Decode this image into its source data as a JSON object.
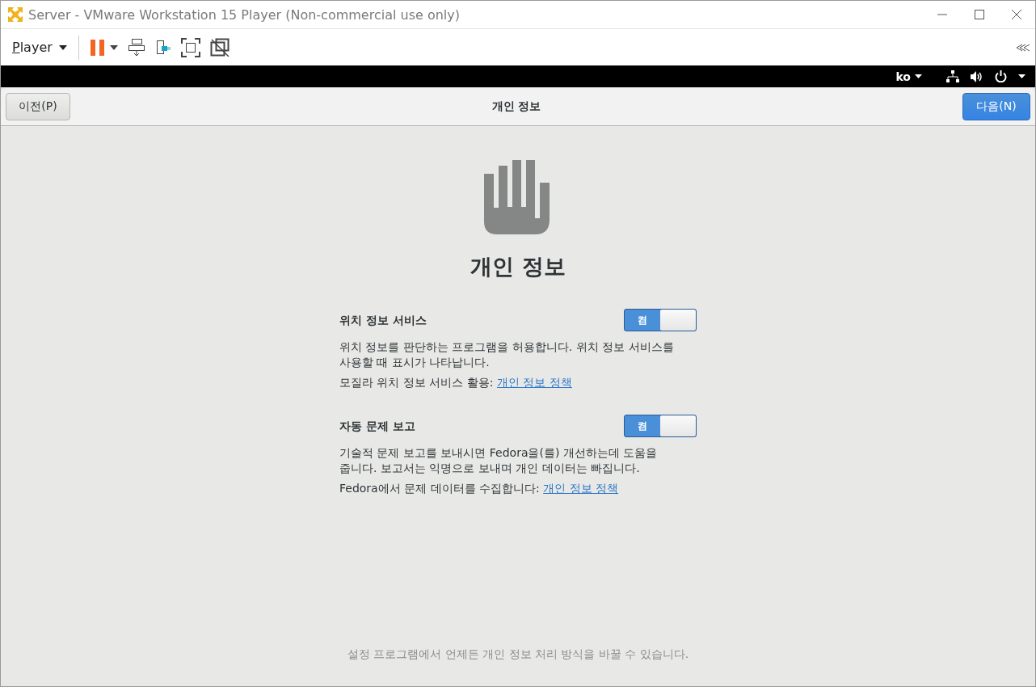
{
  "window": {
    "title": "Server - VMware Workstation 15 Player (Non-commercial use only)"
  },
  "toolbar": {
    "menu": "Player"
  },
  "top_bar": {
    "language": "ko"
  },
  "header": {
    "back": "이전(P)",
    "title": "개인 정보",
    "next": "다음(N)"
  },
  "page": {
    "heading": "개인 정보",
    "settings": [
      {
        "title": "위치 정보 서비스",
        "on": true,
        "switch_label": "켬",
        "description": "위치 정보를 판단하는 프로그램을 허용합니다. 위치 정보 서비스를 사용할 때 표시가 나타납니다.",
        "link_prefix": "모질라 위치 정보 서비스 활용:",
        "link": "개인 정보 정책"
      },
      {
        "title": "자동 문제 보고",
        "on": true,
        "switch_label": "켬",
        "description": "기술적 문제 보고를 보내시면 Fedora을(를) 개선하는데 도움을 줍니다. 보고서는 익명으로 보내며 개인 데이터는 빠집니다.",
        "link_prefix": "Fedora에서 문제 데이터를 수집합니다:",
        "link": "개인 정보 정책"
      }
    ]
  },
  "footer": "설정 프로그램에서 언제든 개인 정보 처리 방식을 바꿀 수 있습니다."
}
